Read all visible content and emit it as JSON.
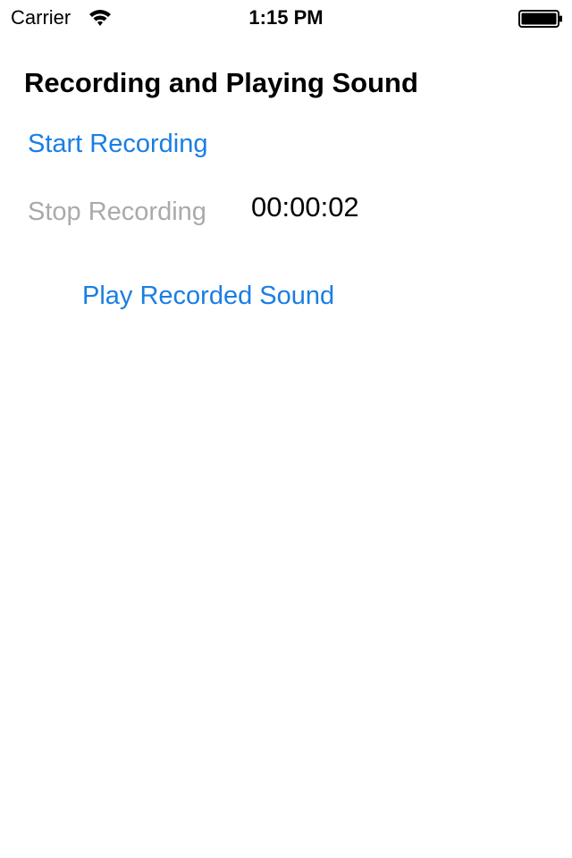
{
  "status_bar": {
    "carrier": "Carrier",
    "time": "1:15 PM",
    "wifi_icon": "wifi-icon",
    "battery_icon": "battery-full-icon"
  },
  "screen": {
    "title": "Recording and Playing Sound",
    "start_label": "Start Recording",
    "stop_label": "Stop Recording",
    "timer": "00:00:02",
    "play_label": "Play Recorded Sound"
  },
  "colors": {
    "accent": "#1a7ee3",
    "disabled": "#aaaaaa",
    "text": "#000000",
    "background": "#ffffff"
  }
}
